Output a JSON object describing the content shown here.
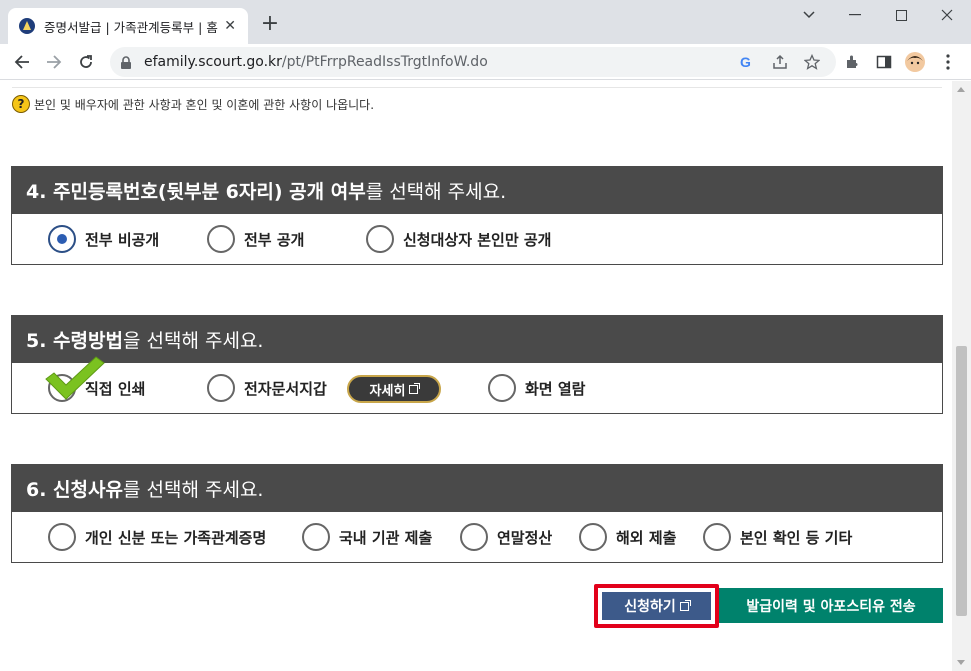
{
  "browser": {
    "tab_title": "증명서발급 | 가족관계등록부 | 홈",
    "url_host": "efamily.scourt.go.kr",
    "url_path": "/pt/PtFrrpReadIssTrgtInfoW.do"
  },
  "help_text": "본인 및 배우자에 관한 사항과 혼인 및 이혼에 관한 사항이 나옵니다.",
  "sections": [
    {
      "title_bold": "4. 주민등록번호(뒷부분 6자리) 공개 여부",
      "title_rest": "를 선택해 주세요.",
      "options": [
        "전부 비공개",
        "전부 공개",
        "신청대상자 본인만 공개"
      ],
      "selected": "전부 비공개"
    },
    {
      "title_bold": "5. 수령방법",
      "title_rest": "을 선택해 주세요.",
      "options": [
        "직접 인쇄",
        "전자문서지갑",
        "화면 열람"
      ],
      "detail_button": "자세히"
    },
    {
      "title_bold": "6. 신청사유",
      "title_rest": "를 선택해 주세요.",
      "options": [
        "개인 신분 또는 가족관계증명",
        "국내 기관 제출",
        "연말정산",
        "해외 제출",
        "본인 확인 등 기타"
      ]
    }
  ],
  "buttons": {
    "apply": "신청하기",
    "history": "발급이력 및 아포스티유 전송"
  },
  "colors": {
    "section_header": "#4a4a4a",
    "apply_button": "#3d5a8a",
    "apply_highlight": "#e2001a",
    "history_button": "#00826c",
    "checkmark": "#7bc220"
  }
}
